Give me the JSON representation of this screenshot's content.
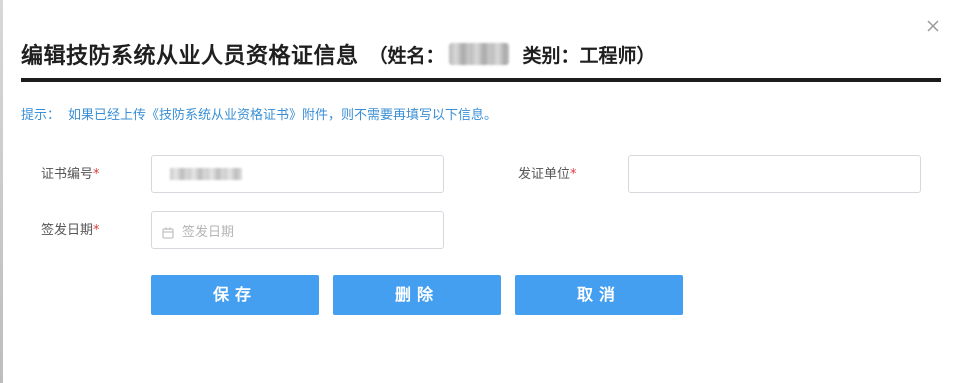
{
  "dialog": {
    "title": "编辑技防系统从业人员资格证信息",
    "subtitle_open": "（姓名：",
    "category_text": "类别：工程师）",
    "close_icon": "close-icon"
  },
  "notice": {
    "prefix": "提示：",
    "text": "如果已经上传《技防系统从业资格证书》附件，则不需要再填写以下信息。"
  },
  "form": {
    "cert_number": {
      "label": "证书编号",
      "required_mark": "*"
    },
    "issuer": {
      "label": "发证单位",
      "required_mark": "*",
      "value": ""
    },
    "issue_date": {
      "label": "签发日期",
      "required_mark": "*",
      "placeholder": "签发日期",
      "icon": "calendar-icon"
    }
  },
  "buttons": {
    "save": "保存",
    "delete": "删除",
    "cancel": "取消"
  },
  "colors": {
    "primary_button": "#449ff0",
    "notice_text": "#3a8fd6",
    "required_mark": "#e23b3b",
    "header_rule": "#1c1c1c"
  }
}
